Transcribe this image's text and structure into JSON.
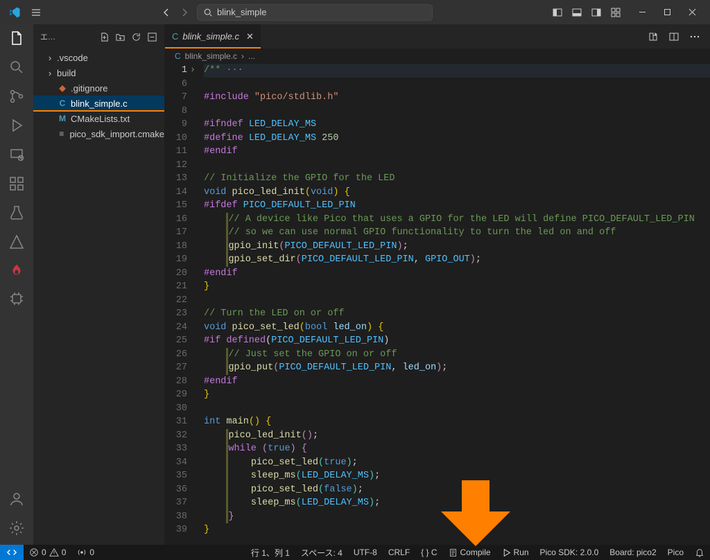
{
  "title_search": "blink_simple",
  "sidebar_title": "エ...",
  "tree": {
    "vscode": ".vscode",
    "build": "build",
    "gitignore": ".gitignore",
    "blink": "blink_simple.c",
    "cmake": "CMakeLists.txt",
    "pico": "pico_sdk_import.cmake"
  },
  "tab": {
    "label": "blink_simple.c"
  },
  "breadcrumb": {
    "file": "blink_simple.c",
    "sep": "›",
    "more": "..."
  },
  "line_numbers": [
    "1",
    "6",
    "7",
    "8",
    "9",
    "10",
    "11",
    "12",
    "13",
    "14",
    "15",
    "16",
    "17",
    "18",
    "19",
    "20",
    "21",
    "22",
    "23",
    "24",
    "25",
    "26",
    "27",
    "28",
    "29",
    "30",
    "31",
    "32",
    "33",
    "34",
    "35",
    "36",
    "37",
    "38",
    "39"
  ],
  "status_left": {
    "errors": "0",
    "warnings": "0",
    "ports": "0"
  },
  "status_right": {
    "pos": "行 1、列 1",
    "spaces": "スペース: 4",
    "encoding": "UTF-8",
    "eol": "CRLF",
    "lang": "{ }  C",
    "compile": "Compile",
    "run": "Run",
    "sdk": "Pico SDK: 2.0.0",
    "board": "Board: pico2",
    "pico": "Pico"
  },
  "code_tokens": {
    "comment_fold": "/** ···",
    "include": "#include",
    "include_path": "\"pico/stdlib.h\"",
    "ifndef": "#ifndef",
    "define": "#define",
    "led_delay": "LED_DELAY_MS",
    "led_delay_val": "250",
    "endif": "#endif",
    "cmt_init": "// Initialize the GPIO for the LED",
    "void": "void",
    "pico_led_init": "pico_led_init",
    "ifdef": "#ifdef",
    "default_pin": "PICO_DEFAULT_LED_PIN",
    "cmt_a1": "// A device like Pico that uses a GPIO for the LED will define PICO_DEFAULT_LED_PIN",
    "cmt_a2": "// so we can use normal GPIO functionality to turn the led on and off",
    "gpio_init": "gpio_init",
    "gpio_set_dir": "gpio_set_dir",
    "gpio_out": "GPIO_OUT",
    "cmt_turn": "// Turn the LED on or off",
    "pico_set_led": "pico_set_led",
    "bool": "bool",
    "led_on": "led_on",
    "if_defined": "#if defined",
    "cmt_just": "// Just set the GPIO on or off",
    "gpio_put": "gpio_put",
    "int": "int",
    "main": "main",
    "while": "while",
    "true": "true",
    "false": "false",
    "sleep_ms": "sleep_ms"
  }
}
